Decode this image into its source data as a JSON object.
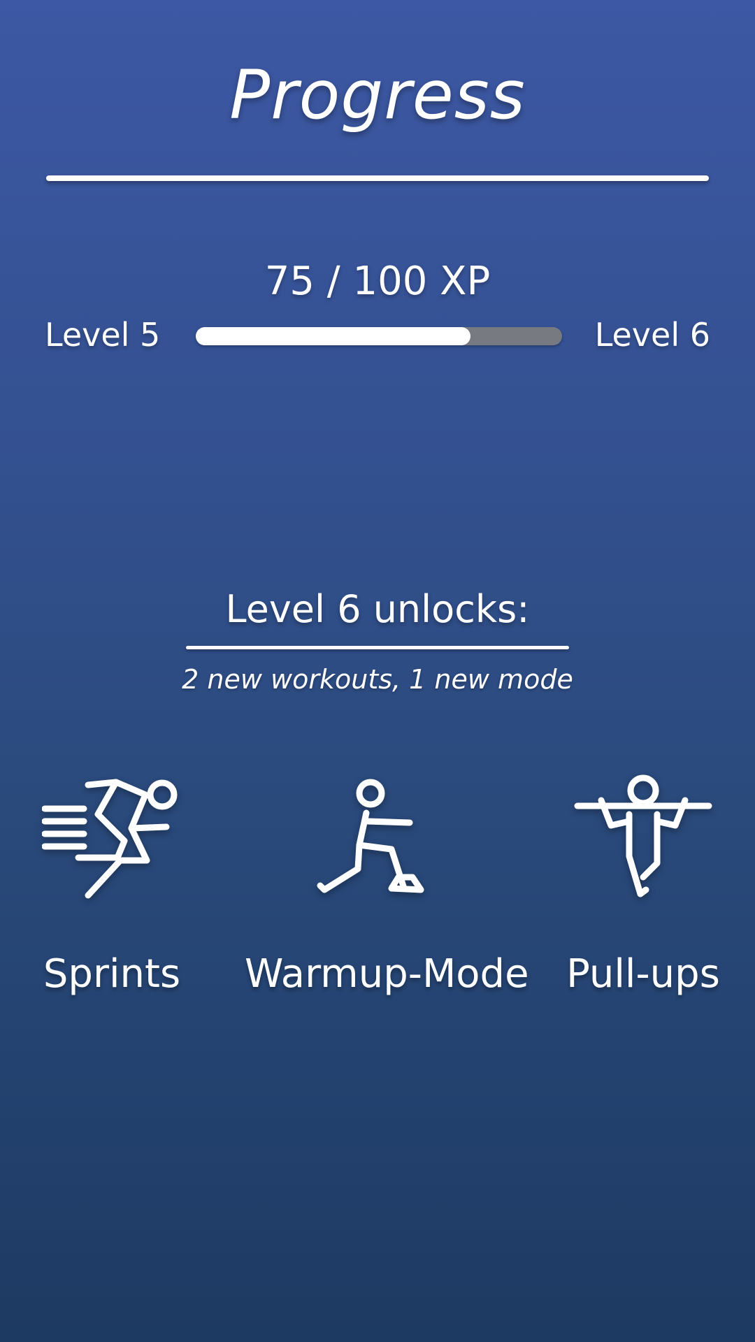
{
  "page": {
    "title": "Progress"
  },
  "progress": {
    "xp_text": "75 / 100 XP",
    "current_level_label": "Level 5",
    "next_level_label": "Level 6",
    "fill_fraction": 0.75
  },
  "unlocks": {
    "title": "Level 6 unlocks:",
    "subtitle": "2 new workouts, 1 new mode",
    "items": [
      {
        "label": "Sprints",
        "icon": "sprinter-icon"
      },
      {
        "label": "Warmup-Mode",
        "icon": "lunge-stretch-icon"
      },
      {
        "label": "Pull-ups",
        "icon": "pull-up-icon"
      }
    ]
  },
  "colors": {
    "background_top": "#3d58a4",
    "background_bottom": "#1d3a62",
    "progress_fill": "#ffffff",
    "progress_track": "#777a80",
    "text": "#ffffff"
  }
}
